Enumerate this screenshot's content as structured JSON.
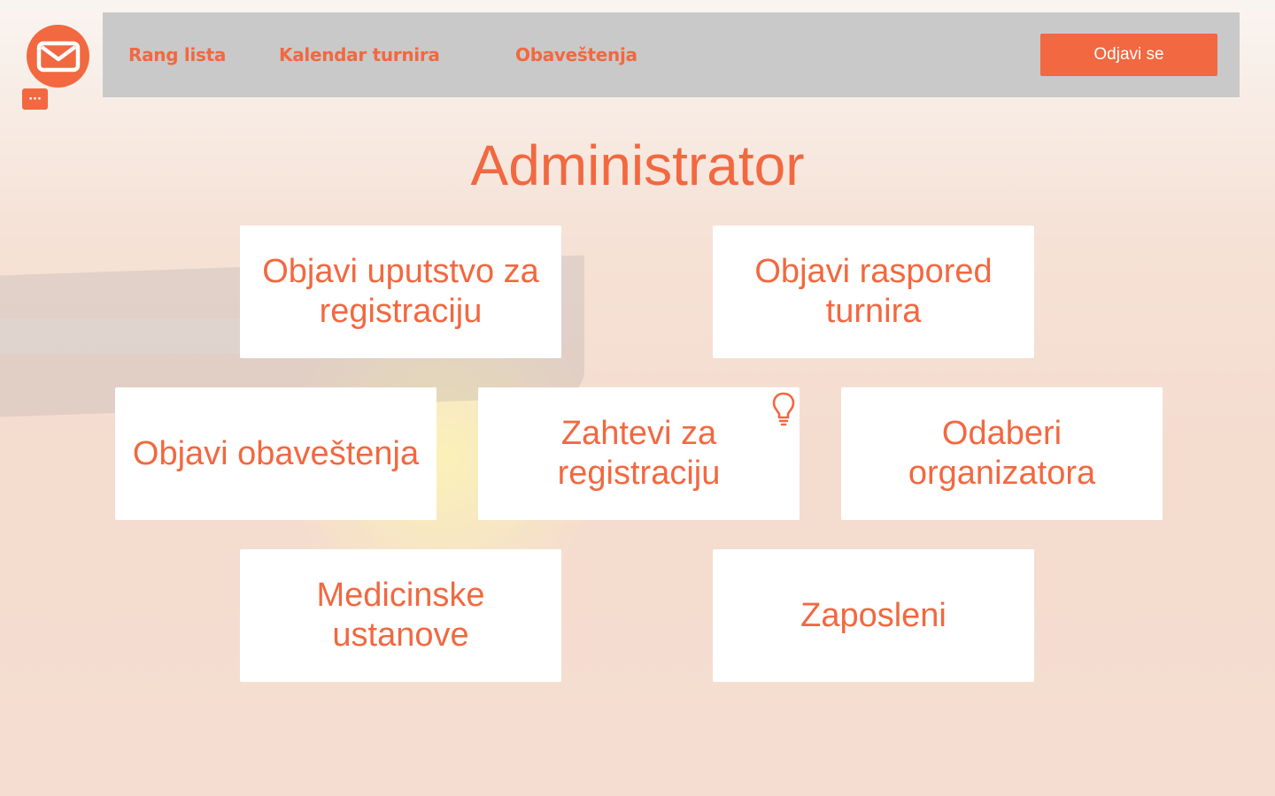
{
  "nav": {
    "links": [
      "Rang lista",
      "Kalendar turnira",
      "Obaveštenja"
    ],
    "logout_label": "Odjavi se"
  },
  "messages": {
    "badge": "···"
  },
  "page": {
    "title": "Administrator"
  },
  "cards": [
    "Objavi uputstvo za registraciju",
    "Objavi raspored turnira",
    "Objavi obaveštenja",
    "Zahtevi za registraciju",
    "Odaberi organizatora",
    "Medicinske ustanove",
    "Zaposleni"
  ],
  "icons": {
    "mail": "mail-icon",
    "bulb": "lightbulb-icon"
  },
  "colors": {
    "accent": "#f26840",
    "navbar": "#c9c9c9",
    "card": "#ffffff"
  }
}
